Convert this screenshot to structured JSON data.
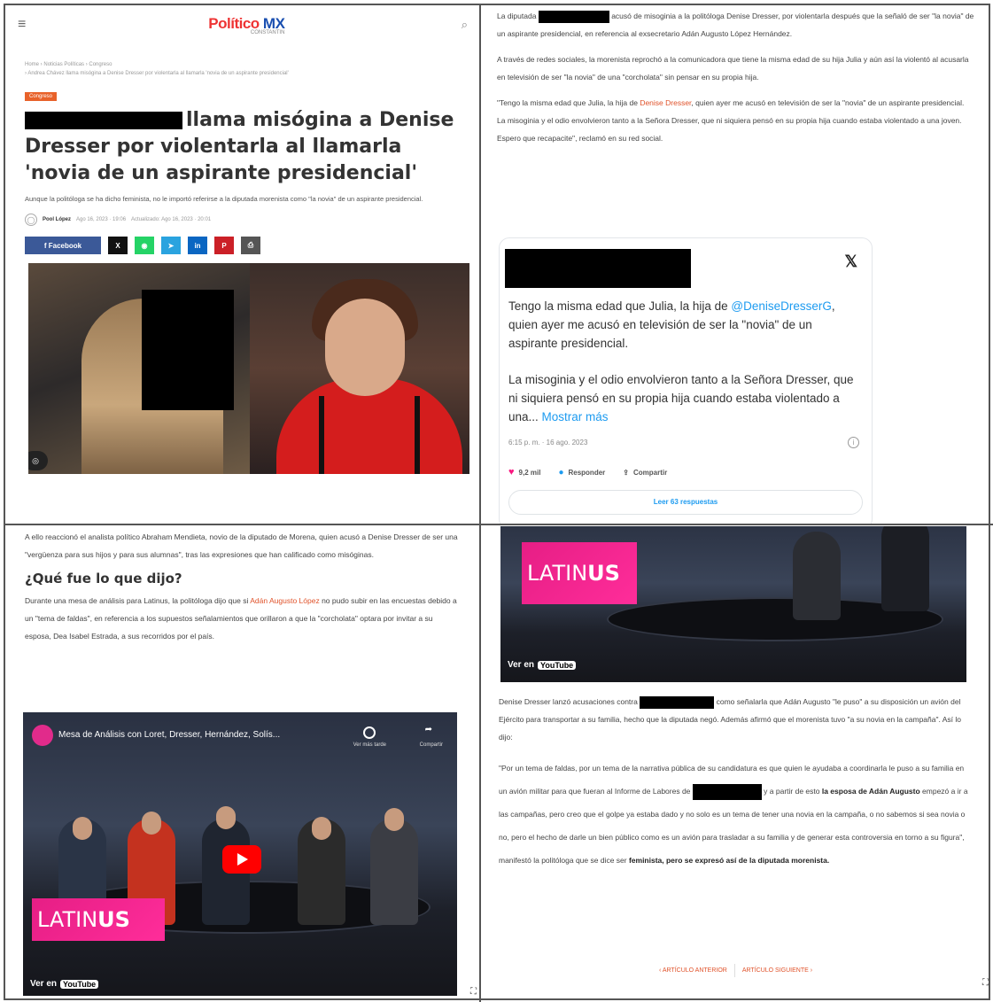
{
  "q1": {
    "logo": {
      "brand": "Político",
      "suffix": "MX",
      "sub": "CONSTANTIN"
    },
    "breadcrumbs": [
      "Home",
      "Noticias Políticas",
      "Congreso"
    ],
    "breadcrumb_current": "› Andrea Chávez llama misógina a Denise Dresser por violentarla al llamarla 'novia de un aspirante presidencial'",
    "tag": "Congreso",
    "headline": "llama misógina a Denise Dresser por violentarla al llamarla 'novia de un aspirante presidencial'",
    "subhead": "Aunque la politóloga se ha dicho feminista, no le importó referirse a la diputada morenista como \"la novia\" de un aspirante presidencial.",
    "byline": {
      "author": "Pool López",
      "published": "Ago 16, 2023 · 19:06",
      "updated": "Actualizado: Ago 16, 2023 · 20:01"
    },
    "share": {
      "facebook": "f   Facebook",
      "x": "X",
      "whatsapp": "◉",
      "telegram": "➤",
      "linkedin": "in",
      "pinterest": "P",
      "print": "⎙"
    }
  },
  "q2": {
    "p1_after": "acusó de misoginia a la politóloga Denise Dresser, por violentarla después que la señaló de ser \"la novia\" de un aspirante presidencial, en referencia al exsecretario Adán Augusto López Hernández.",
    "p1_before": "La diputada",
    "p2": "A través de redes sociales, la morenista reprochó a la comunicadora que tiene la misma edad de su hija Julia y aún así la violentó al acusarla en televisión de ser \"la novia\" de una \"corcholata\" sin pensar en su propia hija.",
    "p3_before": "\"Tengo la misma edad que Julia, la hija de ",
    "p3_link": "Denise Dresser",
    "p3_after": ", quien ayer me acusó en televisión de ser la \"novia\" de un aspirante presidencial. La misoginia y el odio envolvieron tanto a la Señora Dresser, que ni siquiera pensó en su propia hija cuando estaba violentado a una joven. Espero que recapacite\", reclamó en su red social.",
    "tweet": {
      "line1_before": "Tengo la misma edad que Julia, la hija de",
      "mention": "@DeniseDresserG",
      "line1_after": ", quien ayer me acusó en televisión de ser la \"novia\" de un aspirante presidencial.",
      "line2": "La misoginia y el odio envolvieron tanto a la Señora Dresser, que ni siquiera pensó en su propia hija cuando estaba violentado a una...",
      "more": "Mostrar más",
      "time": "6:15 p. m. · 16 ago. 2023",
      "likes": "9,2 mil",
      "reply": "Responder",
      "share": "Compartir",
      "read": "Leer 63 respuestas"
    }
  },
  "q3": {
    "intro": "A ello reaccionó el analista político Abraham Mendieta, novio de la diputado de Morena, quien acusó a Denise Dresser de ser una \"vergüenza para sus hijos y para sus alumnas\", tras las expresiones que han calificado como misóginas.",
    "section_title": "¿Qué fue lo que dijo?",
    "p_before": "Durante una mesa de análisis para Latinus, la politóloga dijo que si ",
    "p_link": "Adán Augusto López",
    "p_after": " no pudo subir en las encuestas debido a un \"tema de faldas\", en referencia a los supuestos señalamientos que orillaron a que la \"corcholata\" optara por invitar a su esposa, Dea Isabel Estrada, a sus recorridos por el país.",
    "video": {
      "title": "Mesa de Análisis con Loret, Dresser, Hernández, Solís...",
      "watch_later": "Ver más tarde",
      "share": "Compartir",
      "brand_a": "LATIN",
      "brand_b": "US",
      "watch_on": "Ver en",
      "yt": "YouTube"
    }
  },
  "q4": {
    "video": {
      "brand_a": "LATIN",
      "brand_b": "US",
      "watch_on": "Ver en",
      "yt": "YouTube"
    },
    "p1_before": "Denise Dresser lanzó acusaciones contra",
    "p1_after": "como señalarla que Adán Augusto \"le puso\" a su disposición un avión del Ejército para transportar a su familia, hecho que la diputada negó. Además afirmó que el morenista tuvo \"a su novia en la campaña\". Así lo dijo:",
    "p2_a": "\"Por un tema de faldas, por un tema de la narrativa pública de su candidatura es que quien le ayudaba a coordinarla le puso a su familia en un avión militar para que fueran al Informe de Labores de",
    "p2_b": "y a partir de esto ",
    "p2_bold": "la esposa de Adán Augusto",
    "p2_c": " empezó a ir a las campañas, pero creo que el golpe ya estaba dado y no solo es un tema de tener una novia en la campaña, o no sabemos si sea novia o no, pero el hecho de darle un bien público como es un avión para trasladar a su familia y de generar esta controversia en torno a su figura\", manifestó la politóloga que se dice ser ",
    "p2_bold2": "feminista, pero se expresó así de la diputada morenista.",
    "prev": "‹  ARTÍCULO ANTERIOR",
    "next": "ARTÍCULO SIGUIENTE  ›"
  }
}
